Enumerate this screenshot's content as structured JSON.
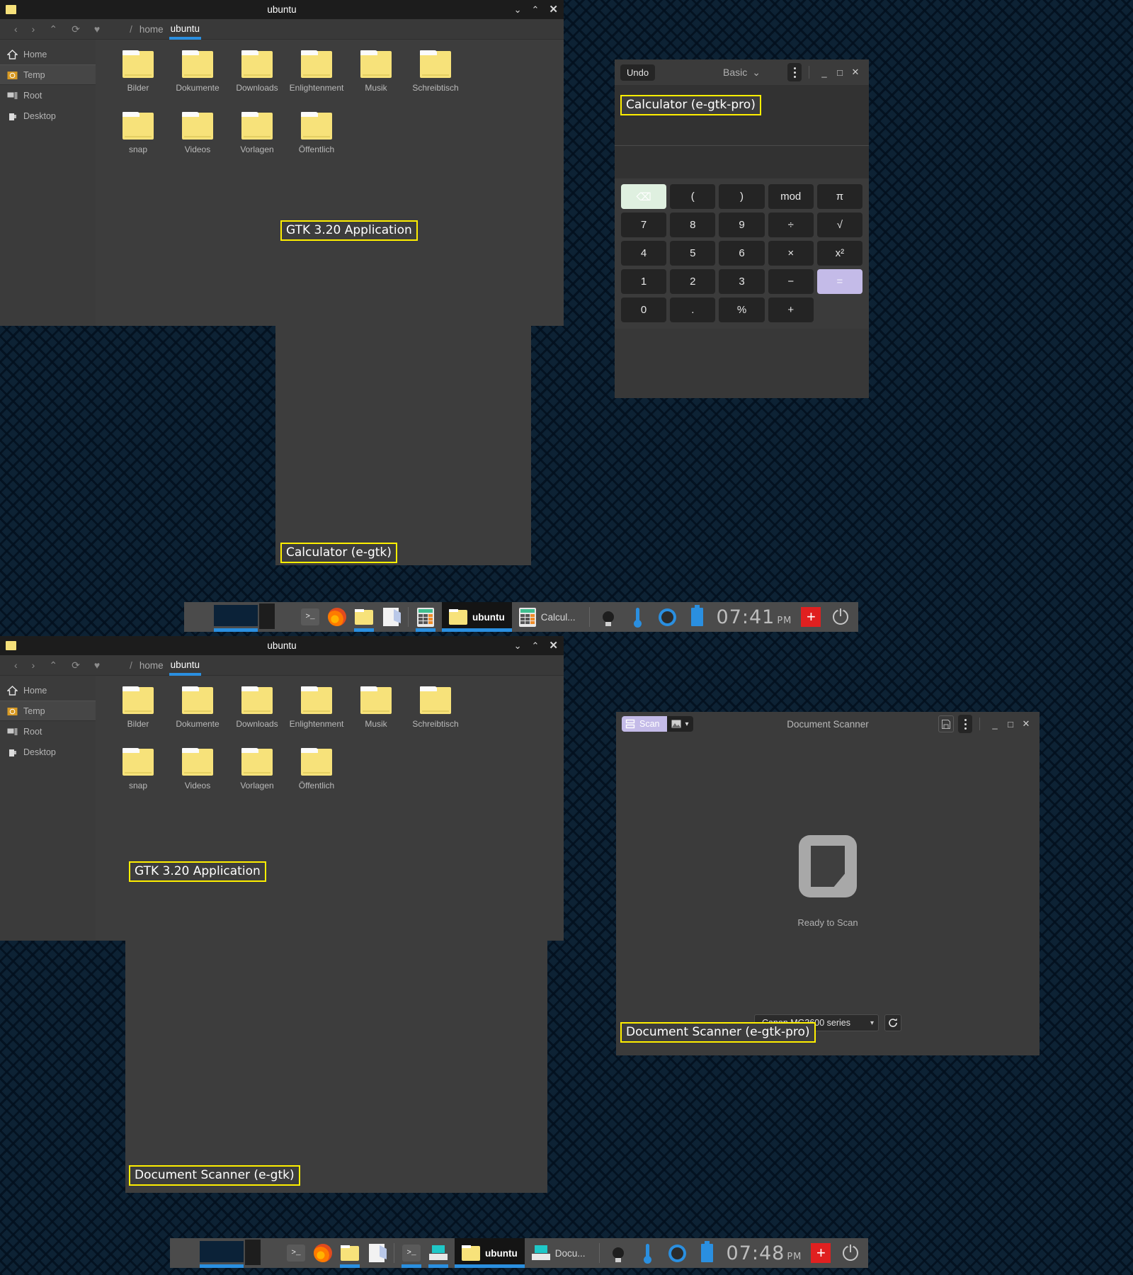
{
  "desktop": {
    "background_color": "#0d2234",
    "pattern": "greek-key"
  },
  "file_manager_top": {
    "title": "ubuntu",
    "window_controls": {
      "shade": "⌄",
      "unshade": "⌃",
      "close": "✕"
    },
    "toolbar": {
      "back": "‹",
      "forward": "›",
      "up": "⌃",
      "reload": "⟳",
      "favorite": "♥"
    },
    "breadcrumb": {
      "root": "/",
      "items": [
        "home",
        "ubuntu"
      ],
      "active": "ubuntu"
    },
    "sidebar": [
      {
        "label": "Home",
        "icon": "home-icon",
        "selected": false
      },
      {
        "label": "Temp",
        "icon": "temp-folder-icon",
        "selected": true
      },
      {
        "label": "Root",
        "icon": "computer-icon",
        "selected": false
      },
      {
        "label": "Desktop",
        "icon": "desktop-icon",
        "selected": false
      }
    ],
    "folders": [
      "Bilder",
      "Dokumente",
      "Downloads",
      "Enlightenment",
      "Musik",
      "Schreibtisch",
      "snap",
      "Videos",
      "Vorlagen",
      "Öffentlich"
    ],
    "annotations": [
      {
        "text": "GTK 3.20 Application"
      }
    ]
  },
  "file_manager_bottom": {
    "title": "ubuntu",
    "window_controls": {
      "shade": "⌄",
      "unshade": "⌃",
      "close": "✕"
    },
    "toolbar": {
      "back": "‹",
      "forward": "›",
      "up": "⌃",
      "reload": "⟳",
      "favorite": "♥"
    },
    "breadcrumb": {
      "root": "/",
      "items": [
        "home",
        "ubuntu"
      ],
      "active": "ubuntu"
    },
    "sidebar": [
      {
        "label": "Home",
        "icon": "home-icon",
        "selected": false
      },
      {
        "label": "Temp",
        "icon": "temp-folder-icon",
        "selected": true
      },
      {
        "label": "Root",
        "icon": "computer-icon",
        "selected": false
      },
      {
        "label": "Desktop",
        "icon": "desktop-icon",
        "selected": false
      }
    ],
    "folders": [
      "Bilder",
      "Dokumente",
      "Downloads",
      "Enlightenment",
      "Musik",
      "Schreibtisch",
      "snap",
      "Videos",
      "Vorlagen",
      "Öffentlich"
    ],
    "annotations": [
      {
        "text": "GTK 3.20 Application"
      }
    ]
  },
  "calculator": {
    "undo_label": "Undo",
    "mode_label": "Basic",
    "mode_chevron": "⌄",
    "window_controls": {
      "menu": "kebab-menu-icon",
      "minimize": "_",
      "maximize": "□",
      "close": "✕"
    },
    "display_value": "",
    "keys": [
      "⌫",
      "(",
      ")",
      "mod",
      "π",
      "7",
      "8",
      "9",
      "÷",
      "√",
      "4",
      "5",
      "6",
      "×",
      "x²",
      "1",
      "2",
      "3",
      "−",
      "0",
      ".",
      "%",
      "+",
      "="
    ],
    "accent_color": "#c4bbe8",
    "delete_key_color": "#dff0e0"
  },
  "annotations": {
    "gtk320_top": "GTK 3.20 Application",
    "calc_egtk": "Calculator (e-gtk)",
    "calc_egtk_pro": "Calculator (e-gtk-pro)",
    "gtk320_bottom": "GTK 3.20 Application",
    "scanner_egtk": "Document Scanner (e-gtk)",
    "scanner_egtk_pro": "Document Scanner (e-gtk-pro)"
  },
  "scanner": {
    "title": "Document Scanner",
    "scan_button_label": "Scan",
    "scan_icon": "scanner-icon",
    "mode_icon": "image-mode-icon",
    "mode_chevron": "▾",
    "save_icon": "save-icon",
    "window_controls": {
      "menu": "kebab-menu-icon",
      "minimize": "_",
      "maximize": "□",
      "close": "✕"
    },
    "status_text": "Ready to Scan",
    "device": "Canon MG3600 series",
    "device_chevron": "▾",
    "refresh_icon": "refresh-icon",
    "accent_color": "#c4bbe8"
  },
  "taskbar_top": {
    "pager_icon": "pager-icon",
    "up_arrow": "⌃",
    "launchers": [
      "terminal-icon",
      "firefox-icon",
      "folder-icon",
      "text-editor-icon"
    ],
    "running": [
      "calculator-icon"
    ],
    "tasks": [
      {
        "label": "ubuntu",
        "icon": "folder-icon",
        "active": true
      },
      {
        "label": "Calcul...",
        "icon": "calculator-icon",
        "active": false
      }
    ],
    "tray": [
      "bulb-icon",
      "thermometer-icon",
      "audio-icon",
      "battery-icon"
    ],
    "clock": {
      "time": "07:41",
      "ampm": "PM"
    },
    "swiss_icon": "+",
    "power_icon": "power-icon"
  },
  "taskbar_bottom": {
    "pager_icon": "pager-icon",
    "up_arrow": "⌃",
    "launchers": [
      "terminal-icon",
      "firefox-icon",
      "folder-icon",
      "text-editor-icon"
    ],
    "running": [
      "terminal-icon",
      "scanner-icon"
    ],
    "tasks": [
      {
        "label": "ubuntu",
        "icon": "folder-icon",
        "active": true
      },
      {
        "label": "Docu...",
        "icon": "scanner-icon",
        "active": false
      }
    ],
    "tray": [
      "bulb-icon",
      "thermometer-icon",
      "audio-icon",
      "battery-icon"
    ],
    "clock": {
      "time": "07:48",
      "ampm": "PM"
    },
    "swiss_icon": "+",
    "power_icon": "power-icon"
  }
}
